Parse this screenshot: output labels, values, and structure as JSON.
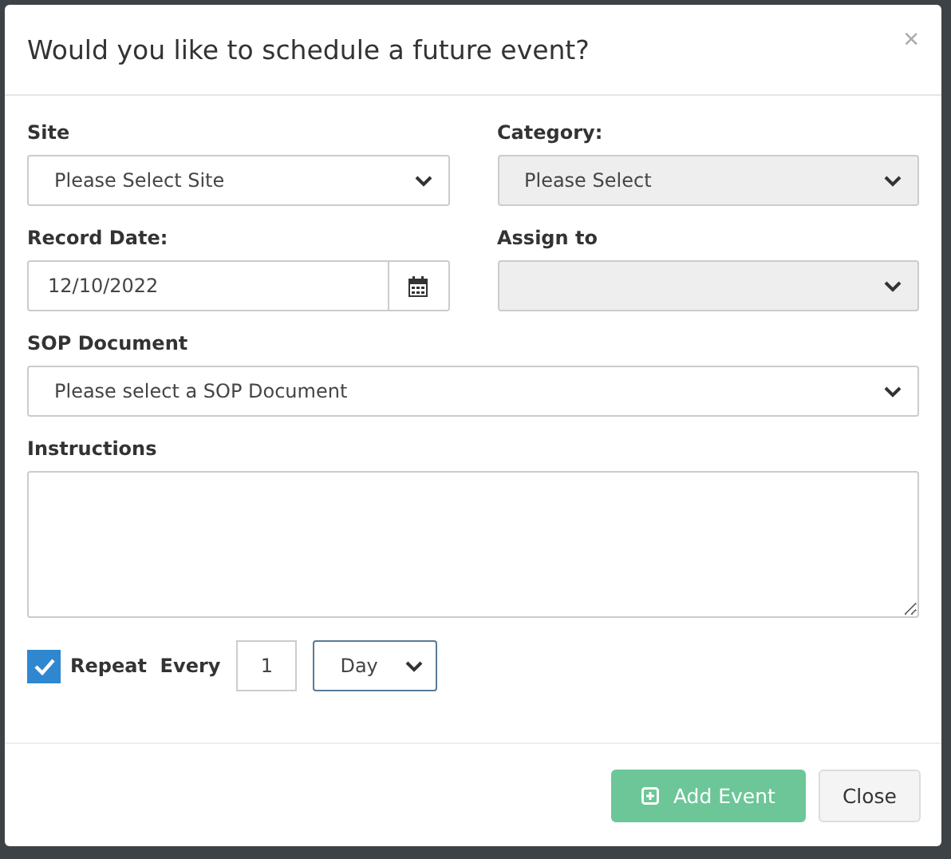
{
  "modal": {
    "title": "Would you like to schedule a future event?",
    "close_icon": "×"
  },
  "fields": [
    {
      "label": "Site",
      "kind": "select",
      "value": "Please Select Site",
      "disabled": false
    },
    {
      "label": "Category:",
      "kind": "select",
      "value": "Please Select",
      "disabled": true
    },
    {
      "label": "Record Date:",
      "kind": "date",
      "value": "12/10/2022",
      "disabled": false
    },
    {
      "label": "Assign to",
      "kind": "select",
      "disabled": true
    },
    {
      "label": "SOP Document",
      "kind": "select",
      "value": "Please select a SOP Document",
      "disabled": false,
      "wide": true
    },
    {
      "label": "Instructions",
      "kind": "textarea",
      "disabled": false,
      "wide": true
    }
  ],
  "repeat": {
    "checked": true,
    "label": "Repeat  Every",
    "count": "1",
    "unit": "Day"
  },
  "buttons": [
    {
      "label": "Add Event",
      "kind": "primary",
      "disabled": true
    },
    {
      "label": "Close",
      "kind": "secondary",
      "disabled": false
    }
  ]
}
